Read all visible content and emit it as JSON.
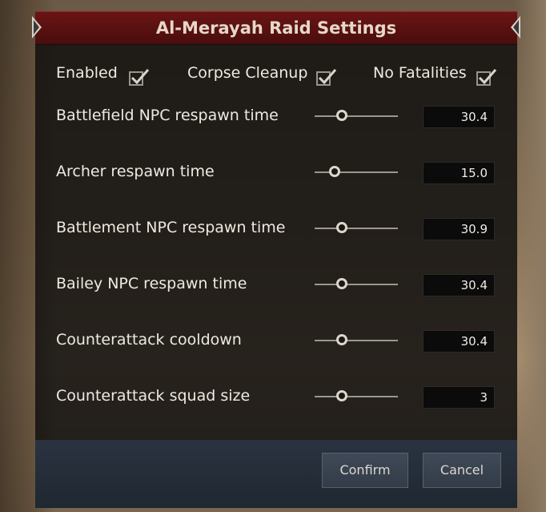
{
  "dialog": {
    "title": "Al-Merayah Raid Settings"
  },
  "toggles": [
    {
      "label": "Enabled",
      "checked": true
    },
    {
      "label": "Corpse Cleanup",
      "checked": true
    },
    {
      "label": "No Fatalities",
      "checked": true
    }
  ],
  "settings": [
    {
      "label": "Battlefield NPC respawn time",
      "value": "30.4",
      "level": 0.33
    },
    {
      "label": "Archer respawn time",
      "value": "15.0",
      "level": 0.25
    },
    {
      "label": "Battlement NPC respawn time",
      "value": "30.9",
      "level": 0.33
    },
    {
      "label": "Bailey NPC respawn time",
      "value": "30.4",
      "level": 0.33
    },
    {
      "label": "Counterattack cooldown",
      "value": "30.4",
      "level": 0.33
    },
    {
      "label": "Counterattack squad size",
      "value": "3",
      "level": 0.33
    }
  ],
  "buttons": {
    "confirm": "Confirm",
    "cancel": "Cancel"
  },
  "colors": {
    "title_bar": "#5a1010",
    "panel_bg": "#12100f",
    "footer_bg": "#26303c",
    "checkmark": "#d9d4cb"
  }
}
